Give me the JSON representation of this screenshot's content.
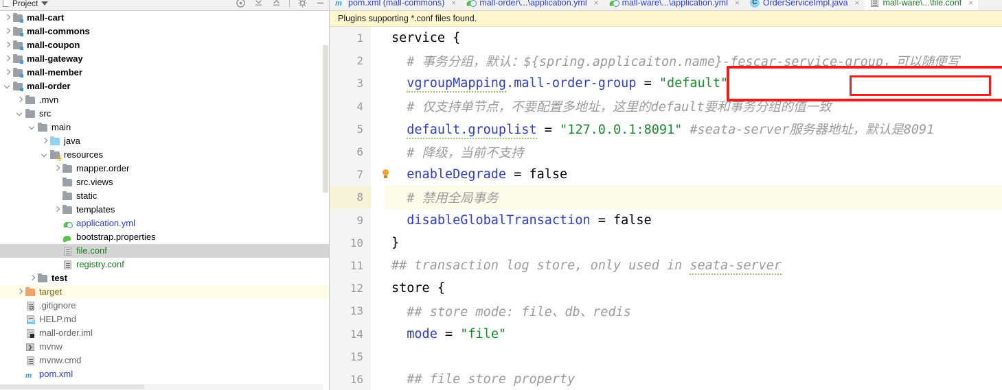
{
  "window": {
    "app": "IntelliJ IDEA",
    "project_panel": {
      "title": "Project",
      "dropdown_icon": "chevron-down-icon",
      "toolbar_icons": [
        "locate-icon",
        "collapse-all-icon",
        "expand-all-icon",
        "settings-gear-icon",
        "hide-icon"
      ]
    }
  },
  "tree": {
    "items": [
      {
        "label": "mall-cart",
        "indent": 0,
        "arrow": "right",
        "icon": "module-folder-icon",
        "style": "bold",
        "state": "normal"
      },
      {
        "label": "mall-commons",
        "indent": 0,
        "arrow": "right",
        "icon": "module-folder-icon",
        "style": "bold",
        "state": "normal"
      },
      {
        "label": "mall-coupon",
        "indent": 0,
        "arrow": "right",
        "icon": "module-folder-icon",
        "style": "bold",
        "state": "normal"
      },
      {
        "label": "mall-gateway",
        "indent": 0,
        "arrow": "right",
        "icon": "module-folder-icon",
        "style": "bold",
        "state": "normal"
      },
      {
        "label": "mall-member",
        "indent": 0,
        "arrow": "right",
        "icon": "module-folder-icon",
        "style": "bold",
        "state": "normal"
      },
      {
        "label": "mall-order",
        "indent": 0,
        "arrow": "down",
        "icon": "module-folder-icon",
        "style": "bold",
        "state": "normal"
      },
      {
        "label": ".mvn",
        "indent": 1,
        "arrow": "right",
        "icon": "folder-icon",
        "style": "plain",
        "state": "normal"
      },
      {
        "label": "src",
        "indent": 1,
        "arrow": "down",
        "icon": "folder-icon",
        "style": "plain",
        "state": "normal"
      },
      {
        "label": "main",
        "indent": 2,
        "arrow": "down",
        "icon": "folder-icon",
        "style": "plain",
        "state": "normal"
      },
      {
        "label": "java",
        "indent": 3,
        "arrow": "right",
        "icon": "source-folder-icon",
        "style": "plain",
        "state": "normal"
      },
      {
        "label": "resources",
        "indent": 3,
        "arrow": "down",
        "icon": "resources-folder-icon",
        "style": "plain",
        "state": "normal"
      },
      {
        "label": "mapper.order",
        "indent": 4,
        "arrow": "right",
        "icon": "folder-icon",
        "style": "plain",
        "state": "normal"
      },
      {
        "label": "src.views",
        "indent": 4,
        "arrow": "none",
        "icon": "folder-icon",
        "style": "plain",
        "state": "normal"
      },
      {
        "label": "static",
        "indent": 4,
        "arrow": "none",
        "icon": "folder-icon",
        "style": "plain",
        "state": "normal"
      },
      {
        "label": "templates",
        "indent": 4,
        "arrow": "right",
        "icon": "folder-icon",
        "style": "plain",
        "state": "normal"
      },
      {
        "label": "application.yml",
        "indent": 4,
        "arrow": "none",
        "icon": "spring-yaml-icon",
        "style": "blue",
        "state": "normal"
      },
      {
        "label": "bootstrap.properties",
        "indent": 4,
        "arrow": "none",
        "icon": "spring-leaf-icon",
        "style": "plain",
        "state": "normal"
      },
      {
        "label": "file.conf",
        "indent": 4,
        "arrow": "none",
        "icon": "conf-file-icon",
        "style": "green",
        "state": "selected"
      },
      {
        "label": "registry.conf",
        "indent": 4,
        "arrow": "none",
        "icon": "conf-file-icon",
        "style": "green",
        "state": "normal"
      },
      {
        "label": "test",
        "indent": 2,
        "arrow": "right",
        "icon": "folder-icon",
        "style": "bold",
        "state": "normal"
      },
      {
        "label": "target",
        "indent": 1,
        "arrow": "right",
        "icon": "excluded-folder-icon",
        "style": "orange",
        "state": "highlight"
      },
      {
        "label": ".gitignore",
        "indent": 1,
        "arrow": "none",
        "icon": "gitignore-file-icon",
        "style": "grey",
        "state": "normal"
      },
      {
        "label": "HELP.md",
        "indent": 1,
        "arrow": "none",
        "icon": "markdown-file-icon",
        "style": "grey",
        "state": "normal"
      },
      {
        "label": "mall-order.iml",
        "indent": 1,
        "arrow": "none",
        "icon": "iml-file-icon",
        "style": "grey",
        "state": "normal"
      },
      {
        "label": "mvnw",
        "indent": 1,
        "arrow": "none",
        "icon": "script-file-icon",
        "style": "grey",
        "state": "normal"
      },
      {
        "label": "mvnw.cmd",
        "indent": 1,
        "arrow": "none",
        "icon": "cmd-file-icon",
        "style": "grey",
        "state": "normal"
      },
      {
        "label": "pom.xml",
        "indent": 1,
        "arrow": "none",
        "icon": "maven-pom-icon",
        "style": "blue",
        "state": "normal"
      }
    ]
  },
  "editor": {
    "tabs": [
      {
        "label": "pom.xml (mall-commons)",
        "icon": "maven-pom-icon",
        "color": "blue",
        "active": false,
        "close": "×"
      },
      {
        "label": "mall-order\\...\\application.yml",
        "icon": "spring-yaml-icon",
        "color": "blue",
        "active": false,
        "close": "×"
      },
      {
        "label": "mall-ware\\...\\application.yml",
        "icon": "spring-yaml-icon",
        "color": "blue",
        "active": false,
        "close": "×"
      },
      {
        "label": "OrderServiceImpl.java",
        "icon": "java-class-icon",
        "color": "blue",
        "active": false,
        "close": "×"
      },
      {
        "label": "mall-ware\\...\\file.conf",
        "icon": "conf-file-icon",
        "color": "green",
        "active": true,
        "close": "×"
      }
    ],
    "notification": "Plugins supporting *.conf files found.",
    "lines": [
      {
        "num": "1",
        "caret": false,
        "bulb": false,
        "tokens": [
          {
            "t": "service {",
            "c": "plain"
          }
        ]
      },
      {
        "num": "2",
        "caret": false,
        "bulb": false,
        "tokens": [
          {
            "t": "  # 事务分组，默认：${spring.applicaiton.name}-fescar-service-group，可以随便写",
            "c": "cmt"
          }
        ]
      },
      {
        "num": "3",
        "caret": false,
        "bulb": false,
        "tokens": [
          {
            "t": "  ",
            "c": "plain"
          },
          {
            "t": "vgroupMapping",
            "c": "key-squig"
          },
          {
            "t": ".mall-order-group",
            "c": "key"
          },
          {
            "t": " = ",
            "c": "op"
          },
          {
            "t": "\"default\"",
            "c": "str"
          }
        ]
      },
      {
        "num": "4",
        "caret": false,
        "bulb": false,
        "tokens": [
          {
            "t": "  # 仅支持单节点，不要配置多地址，这里的default要和事务分组的值一致",
            "c": "cmt"
          }
        ]
      },
      {
        "num": "5",
        "caret": false,
        "bulb": false,
        "tokens": [
          {
            "t": "  ",
            "c": "plain"
          },
          {
            "t": "default.grouplist",
            "c": "key-squig"
          },
          {
            "t": " = ",
            "c": "op"
          },
          {
            "t": "\"127.0.0.1:8091\"",
            "c": "str"
          },
          {
            "t": " #seata-server服务器地址，默认是8091",
            "c": "cmt"
          }
        ]
      },
      {
        "num": "6",
        "caret": false,
        "bulb": false,
        "tokens": [
          {
            "t": "  # 降级，当前不支持",
            "c": "cmt"
          }
        ]
      },
      {
        "num": "7",
        "caret": false,
        "bulb": true,
        "tokens": [
          {
            "t": "  ",
            "c": "plain"
          },
          {
            "t": "enableDegrade",
            "c": "key"
          },
          {
            "t": " = false",
            "c": "op"
          }
        ]
      },
      {
        "num": "8",
        "caret": true,
        "bulb": false,
        "tokens": [
          {
            "t": "  # 禁用全局事务",
            "c": "cmt"
          }
        ]
      },
      {
        "num": "9",
        "caret": false,
        "bulb": false,
        "tokens": [
          {
            "t": "  ",
            "c": "plain"
          },
          {
            "t": "disableGlobalTransaction",
            "c": "key"
          },
          {
            "t": " = false",
            "c": "op"
          }
        ]
      },
      {
        "num": "10",
        "caret": false,
        "bulb": false,
        "tokens": [
          {
            "t": "}",
            "c": "plain"
          }
        ]
      },
      {
        "num": "11",
        "caret": false,
        "bulb": false,
        "tokens": [
          {
            "t": "## transaction log store, only used in ",
            "c": "cmt"
          },
          {
            "t": "seata-server",
            "c": "cmt-squig"
          }
        ]
      },
      {
        "num": "12",
        "caret": false,
        "bulb": false,
        "tokens": [
          {
            "t": "store {",
            "c": "plain"
          }
        ]
      },
      {
        "num": "13",
        "caret": false,
        "bulb": false,
        "tokens": [
          {
            "t": "  ## store mode: file、db、redis",
            "c": "cmt"
          }
        ]
      },
      {
        "num": "14",
        "caret": false,
        "bulb": false,
        "tokens": [
          {
            "t": "  ",
            "c": "plain"
          },
          {
            "t": "mode",
            "c": "key"
          },
          {
            "t": " = ",
            "c": "op"
          },
          {
            "t": "\"file\"",
            "c": "str"
          }
        ]
      },
      {
        "num": "15",
        "caret": false,
        "bulb": false,
        "tokens": [
          {
            "t": "",
            "c": "plain"
          }
        ]
      },
      {
        "num": "16",
        "caret": false,
        "bulb": false,
        "tokens": [
          {
            "t": "  ## file store property",
            "c": "cmt"
          }
        ]
      }
    ]
  },
  "annotations": {
    "outer_box": {
      "shape": "rectangle",
      "color": "#ef1b1b",
      "target": "line-3-vgroupMapping-statement"
    },
    "inner_box": {
      "shape": "rectangle",
      "color": "#ef1b1b",
      "target": "mall-order-group"
    }
  },
  "colors": {
    "keyword": "#2f3fbf",
    "string": "#1a8c2e",
    "comment": "#9b9b9b",
    "annotation_red": "#ef1b1b",
    "notification_bg": "#fdf6cf",
    "caret_line_bg": "#fcfae9",
    "selection_bg": "#d4d4d4",
    "excluded_highlight_bg": "#fffce8"
  }
}
